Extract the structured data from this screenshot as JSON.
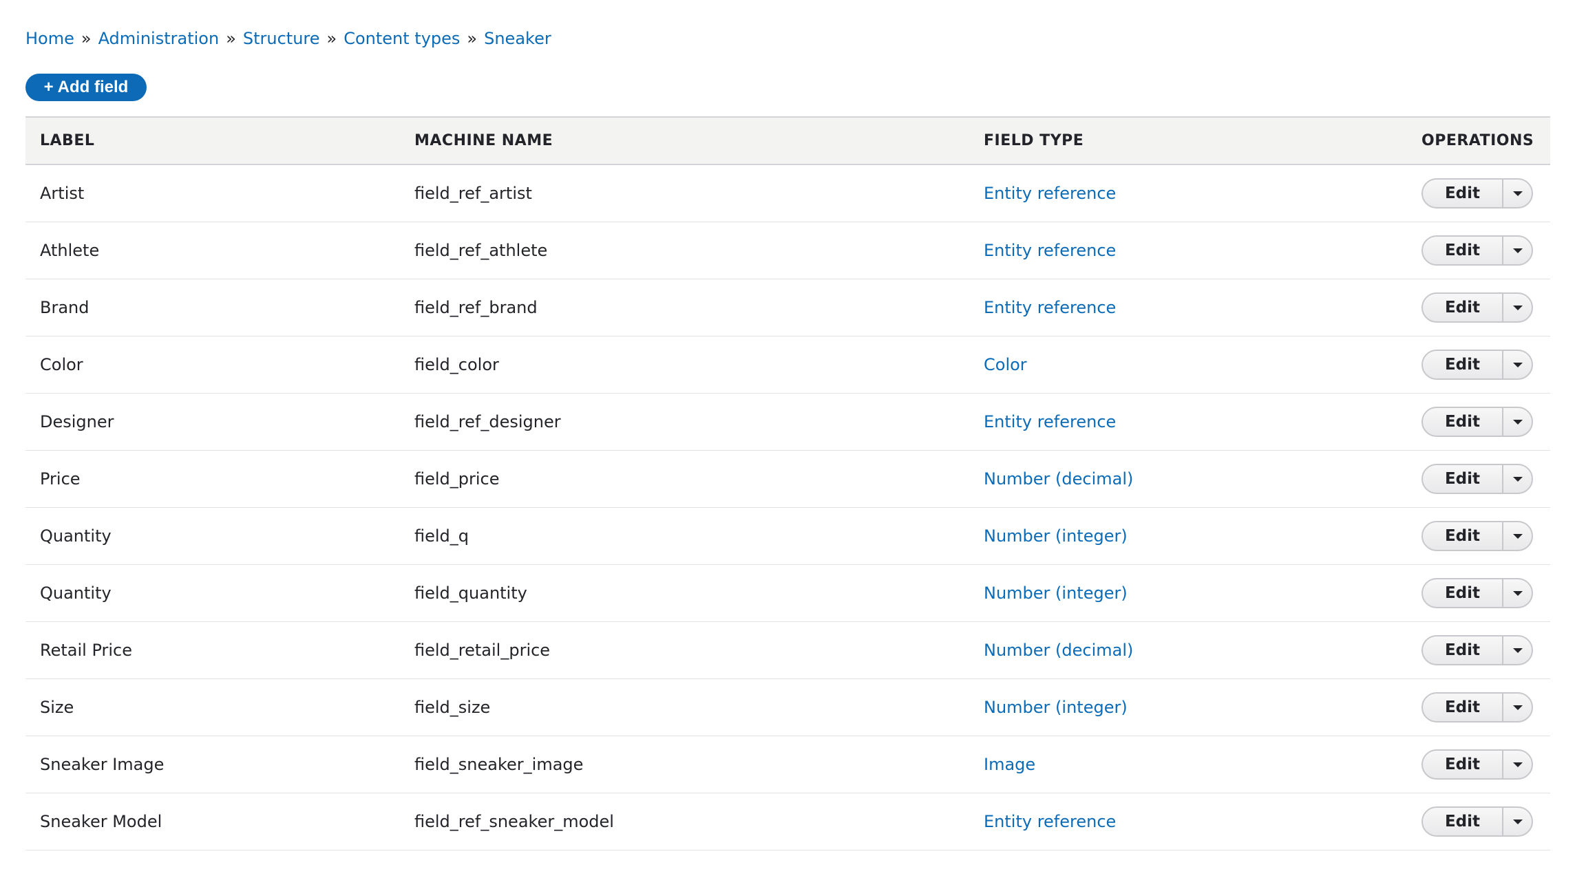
{
  "breadcrumb": {
    "items": [
      "Home",
      "Administration",
      "Structure",
      "Content types",
      "Sneaker"
    ],
    "separator": "»"
  },
  "add_field": {
    "icon": "+",
    "label": "Add field"
  },
  "table": {
    "headers": {
      "label": "LABEL",
      "machine_name": "MACHINE NAME",
      "field_type": "FIELD TYPE",
      "operations": "OPERATIONS"
    },
    "rows": [
      {
        "label": "Artist",
        "machine_name": "field_ref_artist",
        "field_type": "Entity reference",
        "edit": "Edit"
      },
      {
        "label": "Athlete",
        "machine_name": "field_ref_athlete",
        "field_type": "Entity reference",
        "edit": "Edit"
      },
      {
        "label": "Brand",
        "machine_name": "field_ref_brand",
        "field_type": "Entity reference",
        "edit": "Edit"
      },
      {
        "label": "Color",
        "machine_name": "field_color",
        "field_type": "Color",
        "edit": "Edit"
      },
      {
        "label": "Designer",
        "machine_name": "field_ref_designer",
        "field_type": "Entity reference",
        "edit": "Edit"
      },
      {
        "label": "Price",
        "machine_name": "field_price",
        "field_type": "Number (decimal)",
        "edit": "Edit"
      },
      {
        "label": "Quantity",
        "machine_name": "field_q",
        "field_type": "Number (integer)",
        "edit": "Edit"
      },
      {
        "label": "Quantity",
        "machine_name": "field_quantity",
        "field_type": "Number (integer)",
        "edit": "Edit"
      },
      {
        "label": "Retail Price",
        "machine_name": "field_retail_price",
        "field_type": "Number (decimal)",
        "edit": "Edit"
      },
      {
        "label": "Size",
        "machine_name": "field_size",
        "field_type": "Number (integer)",
        "edit": "Edit"
      },
      {
        "label": "Sneaker Image",
        "machine_name": "field_sneaker_image",
        "field_type": "Image",
        "edit": "Edit"
      },
      {
        "label": "Sneaker Model",
        "machine_name": "field_ref_sneaker_model",
        "field_type": "Entity reference",
        "edit": "Edit"
      }
    ]
  },
  "colors": {
    "link": "#0b6bb7",
    "primary_button": "#0d6ab7",
    "header_bg": "#f3f3f2",
    "text": "#232429"
  },
  "icons": {
    "dropdown_toggle": "chevron-down-icon"
  }
}
